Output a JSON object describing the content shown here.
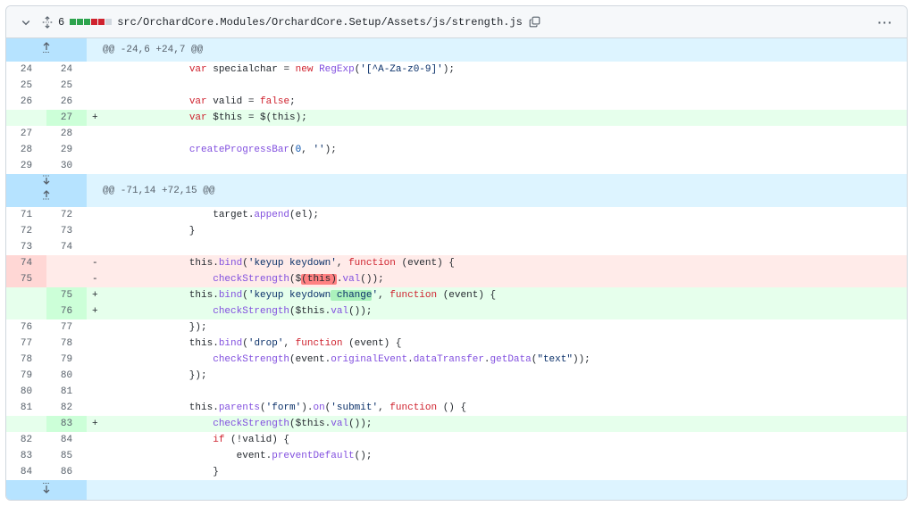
{
  "header": {
    "changes_count": "6",
    "diffstat_colors": [
      "#2da44e",
      "#2da44e",
      "#2da44e",
      "#cf222e",
      "#cf222e",
      "#d0d7de"
    ],
    "file_path": "src/OrchardCore.Modules/OrchardCore.Setup/Assets/js/strength.js",
    "icons": {
      "collapse": "chevron-down-icon",
      "expand": "unfold-icon",
      "copy": "copy-icon",
      "menu": "kebab-horizontal-icon"
    }
  },
  "hunks": [
    {
      "header": "@@ -24,6 +24,7 @@",
      "lines": [
        {
          "type": "ctx",
          "old": "24",
          "new": "24",
          "code": "        var specialchar = new RegExp('[^A-Za-z0-9]');"
        },
        {
          "type": "ctx",
          "old": "25",
          "new": "25",
          "code": ""
        },
        {
          "type": "ctx",
          "old": "26",
          "new": "26",
          "code": "        var valid = false;"
        },
        {
          "type": "add",
          "old": "",
          "new": "27",
          "code": "        var $this = $(this);"
        },
        {
          "type": "ctx",
          "old": "27",
          "new": "28",
          "code": ""
        },
        {
          "type": "ctx",
          "old": "28",
          "new": "29",
          "code": "        createProgressBar(0, '');"
        },
        {
          "type": "ctx",
          "old": "29",
          "new": "30",
          "code": ""
        }
      ]
    },
    {
      "header": "@@ -71,14 +72,15 @@",
      "lines": [
        {
          "type": "ctx",
          "old": "71",
          "new": "72",
          "code": "            target.append(el);"
        },
        {
          "type": "ctx",
          "old": "72",
          "new": "73",
          "code": "        }"
        },
        {
          "type": "ctx",
          "old": "73",
          "new": "74",
          "code": ""
        },
        {
          "type": "del",
          "old": "74",
          "new": "",
          "code": "        this.bind('keyup keydown', function (event) {"
        },
        {
          "type": "del",
          "old": "75",
          "new": "",
          "code": "            checkStrength($(this).val());"
        },
        {
          "type": "add",
          "old": "",
          "new": "75",
          "code": "        this.bind('keyup keydown change', function (event) {"
        },
        {
          "type": "add",
          "old": "",
          "new": "76",
          "code": "            checkStrength($this.val());"
        },
        {
          "type": "ctx",
          "old": "76",
          "new": "77",
          "code": "        });"
        },
        {
          "type": "ctx",
          "old": "77",
          "new": "78",
          "code": "        this.bind('drop', function (event) {"
        },
        {
          "type": "ctx",
          "old": "78",
          "new": "79",
          "code": "            checkStrength(event.originalEvent.dataTransfer.getData(\"text\"));"
        },
        {
          "type": "ctx",
          "old": "79",
          "new": "80",
          "code": "        });"
        },
        {
          "type": "ctx",
          "old": "80",
          "new": "81",
          "code": ""
        },
        {
          "type": "ctx",
          "old": "81",
          "new": "82",
          "code": "        this.parents('form').on('submit', function () {"
        },
        {
          "type": "add",
          "old": "",
          "new": "83",
          "code": "            checkStrength($this.val());"
        },
        {
          "type": "ctx",
          "old": "82",
          "new": "84",
          "code": "            if (!valid) {"
        },
        {
          "type": "ctx",
          "old": "83",
          "new": "85",
          "code": "                event.preventDefault();"
        },
        {
          "type": "ctx",
          "old": "84",
          "new": "86",
          "code": "            }"
        }
      ]
    }
  ],
  "markers": {
    "add": "+",
    "del": "-"
  }
}
